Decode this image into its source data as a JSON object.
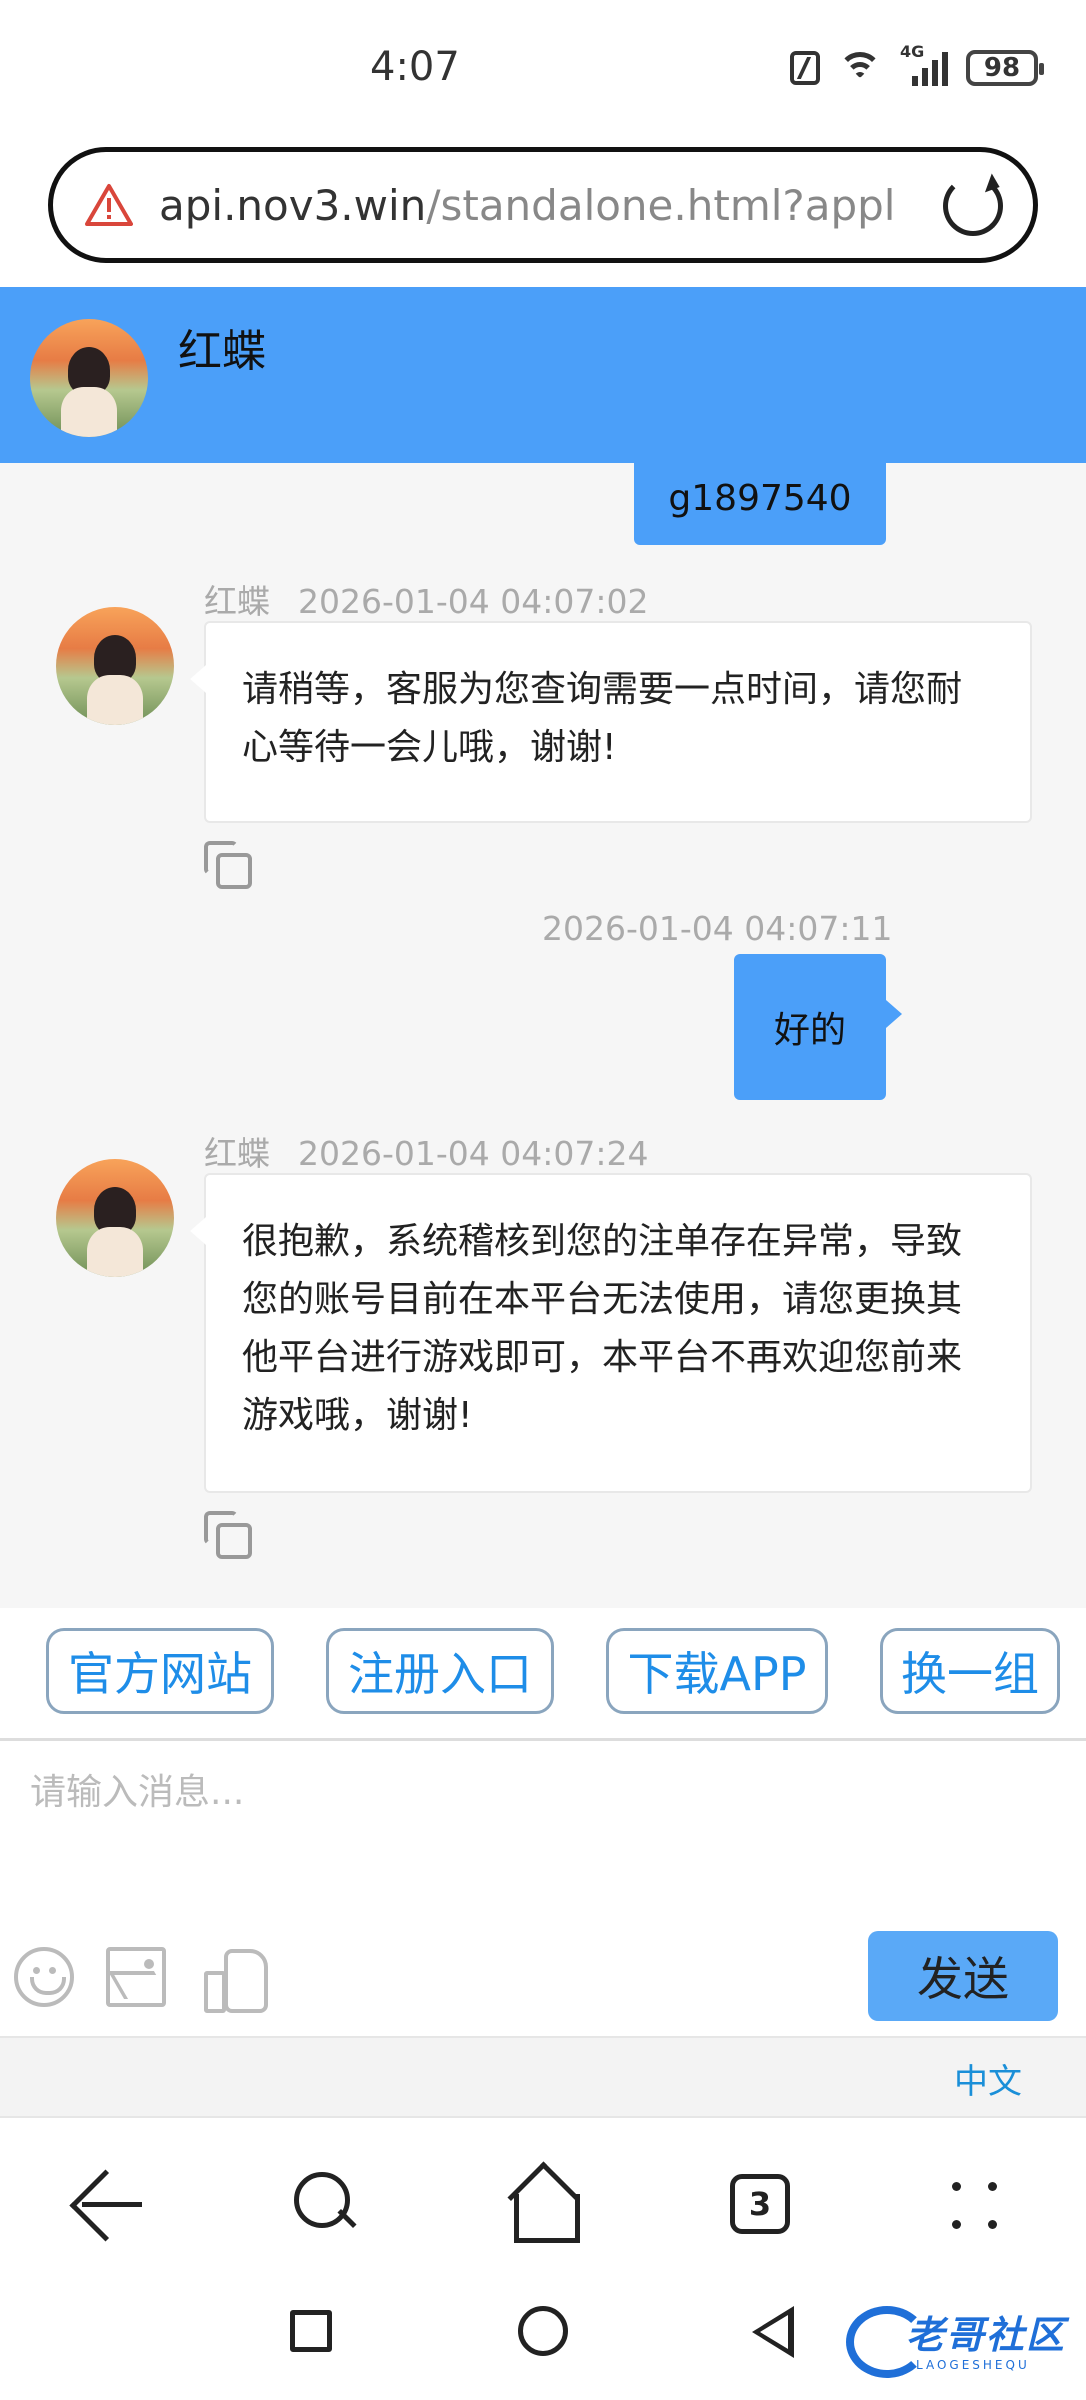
{
  "status_bar": {
    "time": "4:07",
    "network": "4G",
    "battery": "98"
  },
  "address_bar": {
    "host": "api.nov3.win",
    "path": "/standalone.html?appl"
  },
  "chat_header": {
    "agent_name": "红蝶"
  },
  "messages": [
    {
      "direction": "out",
      "text": "g1897540"
    },
    {
      "direction": "in",
      "sender": "红蝶",
      "timestamp": "2026-01-04 04:07:02",
      "text": "请稍等，客服为您查询需要一点时间，请您耐心等待一会儿哦，谢谢!"
    },
    {
      "direction": "out",
      "timestamp": "2026-01-04 04:07:11",
      "text": "好的"
    },
    {
      "direction": "in",
      "sender": "红蝶",
      "timestamp": "2026-01-04 04:07:24",
      "text": "很抱歉，系统稽核到您的注单存在异常，导致您的账号目前在本平台无法使用，请您更换其他平台进行游戏即可，本平台不再欢迎您前来游戏哦，谢谢!"
    }
  ],
  "quick_buttons": [
    "官方网站",
    "注册入口",
    "下载APP",
    "换一组"
  ],
  "composer": {
    "placeholder": "请输入消息...",
    "send_label": "发送"
  },
  "language": {
    "label": "中文"
  },
  "browser_nav": {
    "tab_count": "3"
  },
  "watermark": {
    "text": "老哥社区",
    "subtext": "LAOGESHEQU"
  },
  "colors": {
    "header_blue": "#4b9ff9",
    "bubble_out": "#4b9ff9",
    "quick_text": "#1e8de8",
    "send_button": "#5aa9f7"
  },
  "icons": [
    "nfc-icon",
    "wifi-icon",
    "signal-icon",
    "battery-icon",
    "warning-icon",
    "reload-icon",
    "copy-icon",
    "smile-icon",
    "image-icon",
    "like-icon",
    "back-icon",
    "search-icon",
    "home-icon",
    "tabs-icon",
    "menu-icon"
  ]
}
